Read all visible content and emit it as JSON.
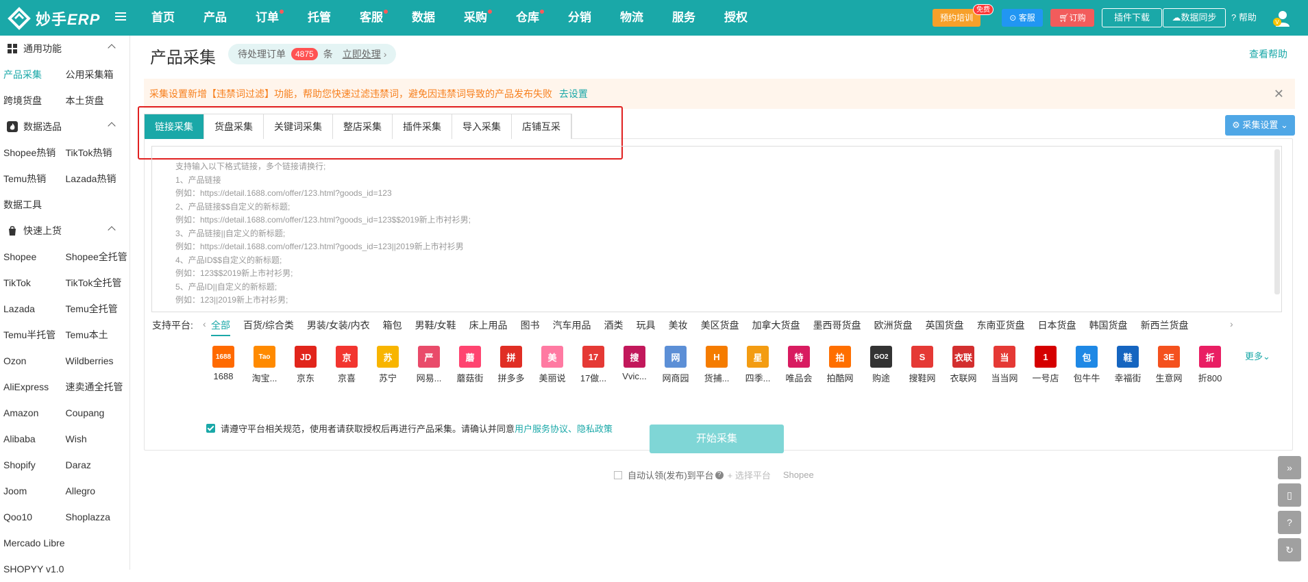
{
  "brand": {
    "name_a": "妙手",
    "name_b": "ERP",
    "accent": "#1aa8a8"
  },
  "nav": [
    {
      "label": "首页",
      "dot": false
    },
    {
      "label": "产品",
      "dot": false
    },
    {
      "label": "订单",
      "dot": true
    },
    {
      "label": "托管",
      "dot": false
    },
    {
      "label": "客服",
      "dot": true
    },
    {
      "label": "数据",
      "dot": false
    },
    {
      "label": "采购",
      "dot": true
    },
    {
      "label": "仓库",
      "dot": true
    },
    {
      "label": "分销",
      "dot": false
    },
    {
      "label": "物流",
      "dot": false
    },
    {
      "label": "服务",
      "dot": false
    },
    {
      "label": "授权",
      "dot": false
    }
  ],
  "topbar": {
    "train": "预约培训",
    "train_badge": "免费",
    "kefu": "客服",
    "order": "订购",
    "plugin": "插件下载",
    "sync": "数据同步",
    "help": "帮助"
  },
  "sidebar": {
    "group1": "通用功能",
    "g1_rows": [
      [
        "产品采集",
        "公用采集箱"
      ],
      [
        "跨境货盘",
        "本土货盘"
      ]
    ],
    "group2": "数据选品",
    "g2_rows": [
      [
        "Shopee热销",
        "TikTok热销"
      ],
      [
        "Temu热销",
        "Lazada热销"
      ],
      [
        "数据工具",
        ""
      ]
    ],
    "group3": "快速上货",
    "g3_rows": [
      [
        "Shopee",
        "Shopee全托管"
      ],
      [
        "TikTok",
        "TikTok全托管"
      ],
      [
        "Lazada",
        "Temu全托管"
      ],
      [
        "Temu半托管",
        "Temu本土"
      ],
      [
        "Ozon",
        "Wildberries"
      ],
      [
        "AliExpress",
        "速卖通全托管"
      ],
      [
        "Amazon",
        "Coupang"
      ],
      [
        "Alibaba",
        "Wish"
      ],
      [
        "Shopify",
        "Daraz"
      ],
      [
        "Joom",
        "Allegro"
      ],
      [
        "Qoo10",
        "Shoplazza"
      ],
      [
        "Mercado Libre",
        ""
      ],
      [
        "SHOPYY v1.0",
        ""
      ]
    ]
  },
  "page": {
    "title": "产品采集",
    "pending_label": "待处理订单",
    "pending_count": "4875",
    "pending_unit": "条",
    "pending_link": "立即处理",
    "help_link": "查看帮助",
    "notice": "采集设置新增【违禁词过滤】功能，帮助您快速过滤违禁词，避免因违禁词导致的产品发布失败",
    "notice_link": "去设置",
    "settings_btn": "采集设置"
  },
  "tabs": [
    "链接采集",
    "货盘采集",
    "关键词采集",
    "整店采集",
    "插件采集",
    "导入采集",
    "店铺互采"
  ],
  "textarea_lines": [
    "支持输入以下格式链接，多个链接请换行;",
    "1、产品链接",
    "例如：https://detail.1688.com/offer/123.html?goods_id=123",
    "2、产品链接$$自定义的新标题;",
    "例如：https://detail.1688.com/offer/123.html?goods_id=123$$2019新上市衬衫男;",
    "3、产品链接||自定义的新标题;",
    "例如：https://detail.1688.com/offer/123.html?goods_id=123||2019新上市衬衫男",
    "4、产品ID$$自定义的新标题;",
    "例如：123$$2019新上市衬衫男;",
    "5、产品ID||自定义的新标题;",
    "例如：123||2019新上市衬衫男;"
  ],
  "platform_label": "支持平台:",
  "filters": [
    "全部",
    "百货/综合类",
    "男装/女装/内衣",
    "箱包",
    "男鞋/女鞋",
    "床上用品",
    "图书",
    "汽车用品",
    "酒类",
    "玩具",
    "美妆",
    "美区货盘",
    "加拿大货盘",
    "墨西哥货盘",
    "欧洲货盘",
    "英国货盘",
    "东南亚货盘",
    "日本货盘",
    "韩国货盘",
    "新西兰货盘"
  ],
  "platforms": [
    {
      "name": "1688",
      "glyph": "1688",
      "color": "#ff6a00"
    },
    {
      "name": "淘宝...",
      "glyph": "Tao",
      "color": "#ff8a00"
    },
    {
      "name": "京东",
      "glyph": "JD",
      "color": "#e1251b"
    },
    {
      "name": "京喜",
      "glyph": "京",
      "color": "#f2352f"
    },
    {
      "name": "苏宁",
      "glyph": "苏",
      "color": "#f8b500"
    },
    {
      "name": "网易...",
      "glyph": "严",
      "color": "#e94b6a"
    },
    {
      "name": "蘑菇街",
      "glyph": "蘑",
      "color": "#ff4470"
    },
    {
      "name": "拼多多",
      "glyph": "拼",
      "color": "#e02e24"
    },
    {
      "name": "美丽说",
      "glyph": "美",
      "color": "#ff7aa2"
    },
    {
      "name": "17做...",
      "glyph": "17",
      "color": "#e53935"
    },
    {
      "name": "Vvic...",
      "glyph": "搜",
      "color": "#c2185b"
    },
    {
      "name": "网商园",
      "glyph": "网",
      "color": "#5c8fd6"
    },
    {
      "name": "货捕...",
      "glyph": "H",
      "color": "#f57c00"
    },
    {
      "name": "四季...",
      "glyph": "星",
      "color": "#f39c12"
    },
    {
      "name": "唯品会",
      "glyph": "特",
      "color": "#d81b60"
    },
    {
      "name": "拍酷网",
      "glyph": "拍",
      "color": "#ff6f00"
    },
    {
      "name": "购途",
      "glyph": "GO2",
      "color": "#333333"
    },
    {
      "name": "搜鞋网",
      "glyph": "S",
      "color": "#e53935"
    },
    {
      "name": "衣联网",
      "glyph": "衣联",
      "color": "#d32f2f"
    },
    {
      "name": "当当网",
      "glyph": "当",
      "color": "#e53935"
    },
    {
      "name": "一号店",
      "glyph": "1",
      "color": "#d50000"
    },
    {
      "name": "包牛牛",
      "glyph": "包",
      "color": "#1e88e5"
    },
    {
      "name": "幸福街",
      "glyph": "鞋",
      "color": "#1565c0"
    },
    {
      "name": "生意网",
      "glyph": "3E",
      "color": "#f4511e"
    },
    {
      "name": "折800",
      "glyph": "折",
      "color": "#e91e63"
    }
  ],
  "more_link": "更多",
  "agree": {
    "text": "请遵守平台相关规范，使用者请获取授权后再进行产品采集。请确认并同意",
    "link1": "用户服务协议",
    "sep": "、",
    "link2": "隐私政策"
  },
  "start_btn": "开始采集",
  "auto": {
    "label": "自动认领(发布)到平台",
    "select": "+ 选择平台",
    "platform": "Shopee"
  }
}
